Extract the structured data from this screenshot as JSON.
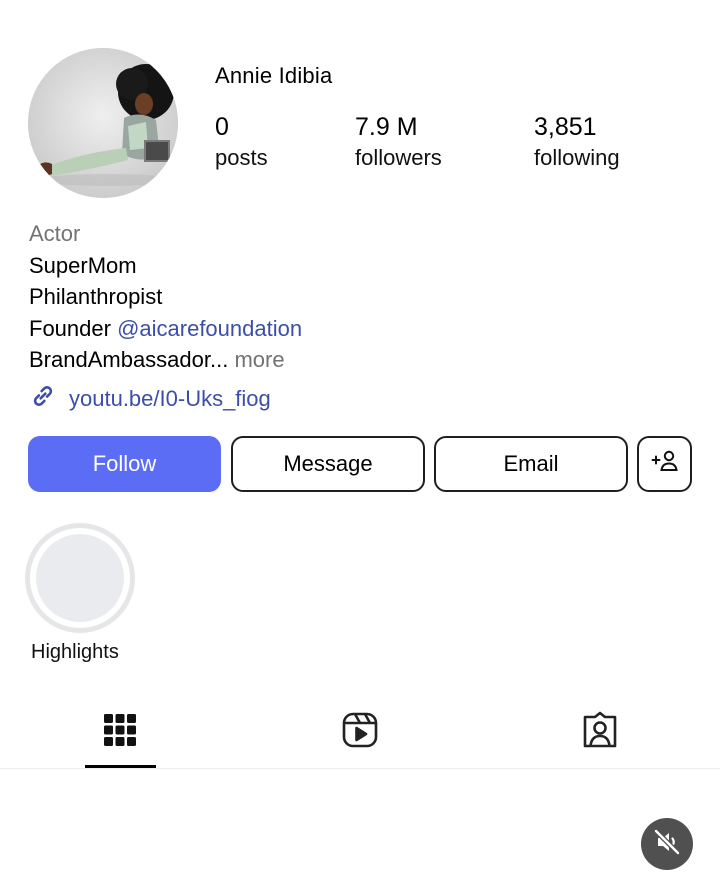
{
  "profile": {
    "username": "Annie Idibia",
    "stats": {
      "posts_count": "0",
      "posts_label": "posts",
      "followers_count": "7.9 M",
      "followers_label": "followers",
      "following_count": "3,851",
      "following_label": "following"
    },
    "bio": {
      "category": "Actor",
      "line1": "SuperMom",
      "line2": "Philanthropist",
      "line3_prefix": "Founder ",
      "line3_mention": "@aicarefoundation",
      "line4": "BrandAmbassador...",
      "more_label": "more"
    },
    "link": "youtu.be/I0-Uks_fiog"
  },
  "actions": {
    "follow_label": "Follow",
    "message_label": "Message",
    "email_label": "Email",
    "add_user_icon": "person-plus-icon"
  },
  "highlights": {
    "label": "Highlights"
  },
  "tabs": {
    "active": "grid",
    "icons": [
      "grid-icon",
      "reels-icon",
      "tagged-icon"
    ]
  },
  "controls": {
    "mute_icon": "speaker-muted-icon"
  },
  "colors": {
    "accent": "#5b6cf5",
    "link": "#3c4ea8",
    "secondary_text": "#737373",
    "mute_button": "#505050"
  }
}
